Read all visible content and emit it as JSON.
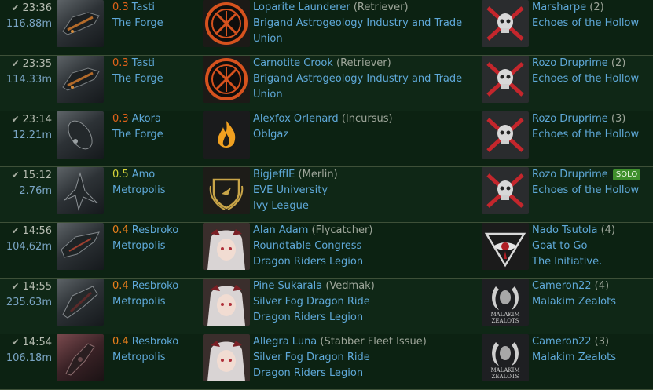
{
  "kills": [
    {
      "time": "23:36",
      "isk": "116.88m",
      "sec": "0.3",
      "system": "Tasti",
      "region": "The Forge",
      "victim": {
        "pilot": "Loparite Launderer",
        "ship": "(Retriever)",
        "corp": "Brigand Astrogeology Industry and Trade Union",
        "alliance": "",
        "logo": "brigand-logo"
      },
      "final_blow": {
        "pilot": "Marsharpe",
        "count": "(2)",
        "corp": "Echoes of the Hollow",
        "corp2": "",
        "solo": "",
        "logo": "echoes-skull-logo"
      }
    },
    {
      "time": "23:35",
      "isk": "114.33m",
      "sec": "0.3",
      "system": "Tasti",
      "region": "The Forge",
      "victim": {
        "pilot": "Carnotite Crook",
        "ship": "(Retriever)",
        "corp": "Brigand Astrogeology Industry and Trade Union",
        "alliance": "",
        "logo": "brigand-logo"
      },
      "final_blow": {
        "pilot": "Rozo Druprime",
        "count": "(2)",
        "corp": "Echoes of the Hollow",
        "corp2": "",
        "solo": "",
        "logo": "echoes-skull-logo"
      }
    },
    {
      "time": "23:14",
      "isk": "12.21m",
      "sec": "0.3",
      "system": "Akora",
      "region": "The Forge",
      "victim": {
        "pilot": "Alexfox Orlenard",
        "ship": "(Incursus)",
        "corp": "Oblgaz",
        "alliance": "",
        "logo": "flame-logo"
      },
      "final_blow": {
        "pilot": "Rozo Druprime",
        "count": "(3)",
        "corp": "Echoes of the Hollow",
        "corp2": "",
        "solo": "",
        "logo": "echoes-skull-logo"
      }
    },
    {
      "time": "15:12",
      "isk": "2.76m",
      "sec": "0.5",
      "system": "Amo",
      "region": "Metropolis",
      "victim": {
        "pilot": "BigjeffIE",
        "ship": "(Merlin)",
        "corp": "EVE University",
        "alliance": "Ivy League",
        "logo": "eve-university-logo"
      },
      "final_blow": {
        "pilot": "Rozo Druprime",
        "count": "",
        "corp": "Echoes of the Hollow",
        "corp2": "",
        "solo": "SOLO",
        "logo": "echoes-skull-logo"
      }
    },
    {
      "time": "14:56",
      "isk": "104.62m",
      "sec": "0.4",
      "system": "Resbroko",
      "region": "Metropolis",
      "victim": {
        "pilot": "Alan Adam",
        "ship": "(Flycatcher)",
        "corp": "Roundtable Congress",
        "alliance": "Dragon Riders Legion",
        "logo": "anime-avatar-logo"
      },
      "final_blow": {
        "pilot": "Nado Tsutola",
        "count": "(4)",
        "corp": "Goat to Go",
        "corp2": "The Initiative.",
        "solo": "",
        "logo": "initiative-logo"
      }
    },
    {
      "time": "14:55",
      "isk": "235.63m",
      "sec": "0.4",
      "system": "Resbroko",
      "region": "Metropolis",
      "victim": {
        "pilot": "Pine Sukarala",
        "ship": "(Vedmak)",
        "corp": "Silver Fog Dragon Ride",
        "alliance": "Dragon Riders Legion",
        "logo": "anime-avatar-logo"
      },
      "final_blow": {
        "pilot": "Cameron22",
        "count": "(4)",
        "corp": "Malakim Zealots",
        "corp2": "",
        "solo": "",
        "logo": "malakim-zealots-logo"
      }
    },
    {
      "time": "14:54",
      "isk": "106.18m",
      "sec": "0.4",
      "system": "Resbroko",
      "region": "Metropolis",
      "victim": {
        "pilot": "Allegra Luna",
        "ship": "(Stabber Fleet Issue)",
        "corp": "Silver Fog Dragon Ride",
        "alliance": "Dragon Riders Legion",
        "logo": "anime-avatar-logo"
      },
      "final_blow": {
        "pilot": "Cameron22",
        "count": "(3)",
        "corp": "Malakim Zealots",
        "corp2": "",
        "solo": "",
        "logo": "malakim-zealots-logo"
      }
    }
  ],
  "logo_texts": {
    "malakim": "MALAKIM",
    "zealots": "ZEALOTS"
  },
  "colors": {
    "sec_0_3": "#e0621a",
    "sec_0_4": "#e97f1c",
    "sec_0_5": "#d6d43a",
    "link": "#5fa9d9",
    "solo_badge": "#3f8f2c"
  }
}
